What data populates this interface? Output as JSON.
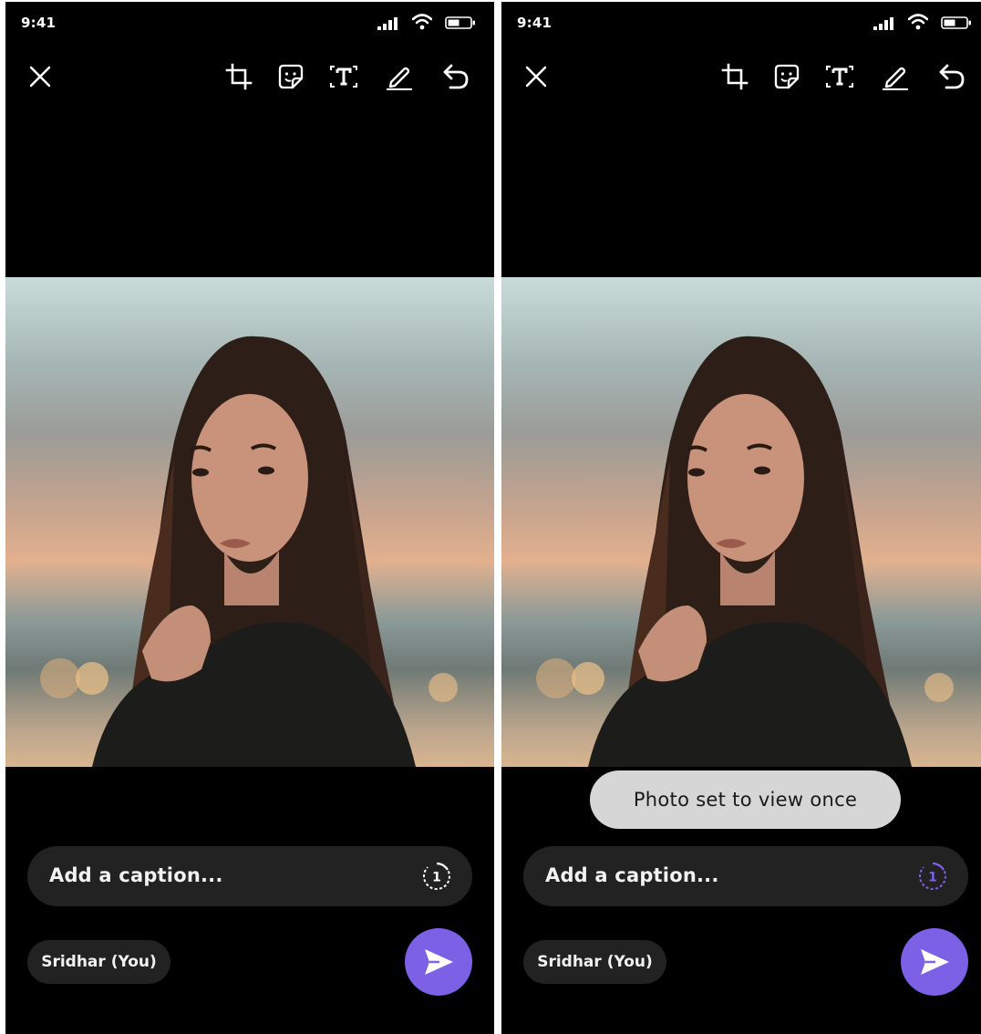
{
  "screens": [
    {
      "status_time": "9:41",
      "caption_placeholder": "Add a caption...",
      "recipient": "Sridhar (You)",
      "view_once_label": "1",
      "view_once_color": "#ffffff",
      "view_once_active": false
    },
    {
      "status_time": "9:41",
      "toast": "Photo set to view once",
      "caption_placeholder": "Add a caption...",
      "recipient": "Sridhar (You)",
      "view_once_label": "1",
      "view_once_color": "#7c60e6",
      "view_once_active": true
    }
  ],
  "toolbar_icons": [
    "close-icon",
    "crop-icon",
    "sticker-icon",
    "text-icon",
    "draw-icon",
    "undo-icon"
  ],
  "colors": {
    "background": "#000000",
    "accent": "#7c60e6",
    "input_bg": "#222222",
    "toast_bg": "#d6d6d6"
  }
}
